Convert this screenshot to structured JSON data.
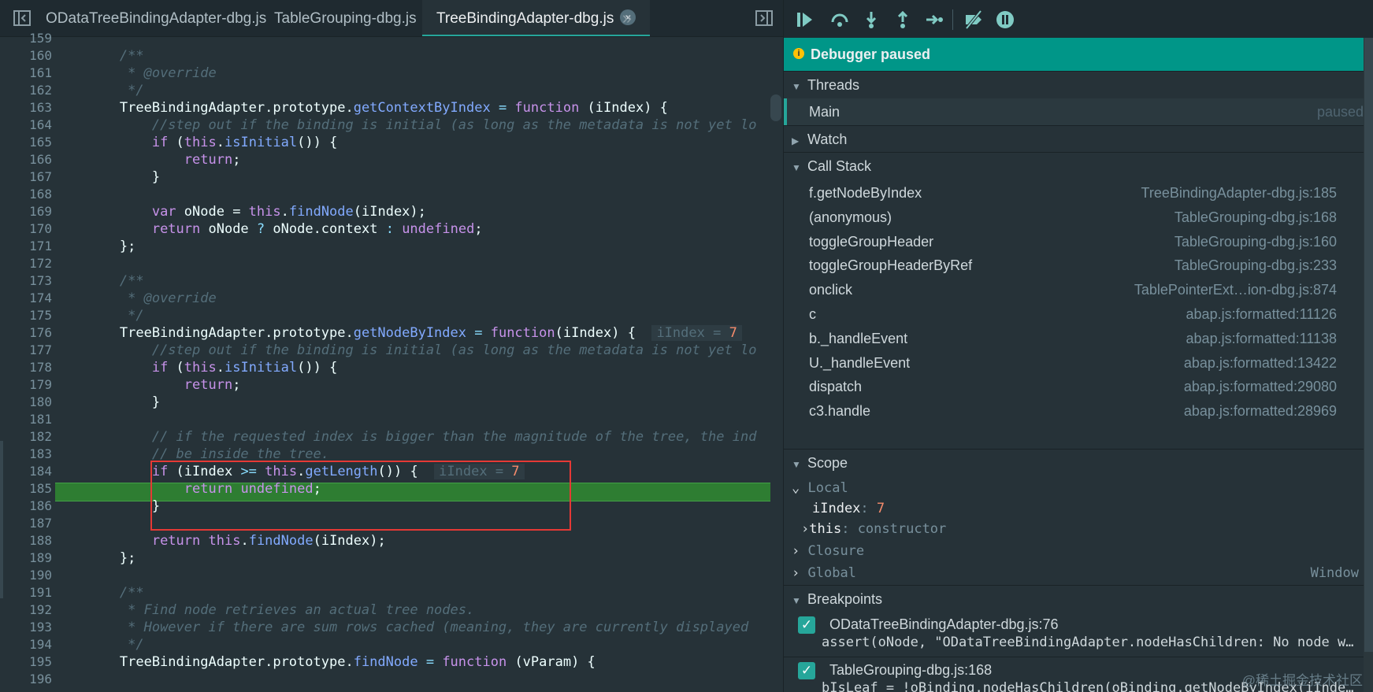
{
  "editor": {
    "tabs": [
      {
        "label": "ODataTreeBindingAdapter-dbg.js"
      },
      {
        "label": "TableGrouping-dbg.js"
      },
      {
        "label": "TreeBindingAdapter-dbg.js",
        "close": "×"
      }
    ],
    "more_tabs": "»",
    "lines": [
      {
        "n": "159",
        "t": []
      },
      {
        "n": "160",
        "t": [
          [
            "        ",
            ""
          ],
          [
            "/**",
            "cm"
          ]
        ]
      },
      {
        "n": "161",
        "t": [
          [
            "         ",
            ""
          ],
          [
            "* @override",
            "cm"
          ]
        ]
      },
      {
        "n": "162",
        "t": [
          [
            "         ",
            ""
          ],
          [
            "*/",
            "cm"
          ]
        ]
      },
      {
        "n": "163",
        "t": [
          [
            "        TreeBindingAdapter.prototype.",
            ""
          ],
          [
            "getContextByIndex",
            "fn"
          ],
          [
            " = ",
            "pn"
          ],
          [
            "function",
            "kw"
          ],
          [
            " (iIndex) {",
            ""
          ]
        ]
      },
      {
        "n": "164",
        "t": [
          [
            "            ",
            ""
          ],
          [
            "//step out if the binding is initial (as long as the metadata is not yet lo",
            "cm"
          ]
        ]
      },
      {
        "n": "165",
        "t": [
          [
            "            ",
            ""
          ],
          [
            "if",
            "kw"
          ],
          [
            " (",
            ""
          ],
          [
            "this",
            "kw"
          ],
          [
            ".",
            ""
          ],
          [
            "isInitial",
            "fn"
          ],
          [
            "()) {",
            ""
          ]
        ]
      },
      {
        "n": "166",
        "t": [
          [
            "                ",
            ""
          ],
          [
            "return",
            "kw"
          ],
          [
            ";",
            ""
          ]
        ]
      },
      {
        "n": "167",
        "t": [
          [
            "            }",
            ""
          ]
        ]
      },
      {
        "n": "168",
        "t": []
      },
      {
        "n": "169",
        "t": [
          [
            "            ",
            ""
          ],
          [
            "var",
            "kw"
          ],
          [
            " oNode = ",
            ""
          ],
          [
            "this",
            "kw"
          ],
          [
            ".",
            ""
          ],
          [
            "findNode",
            "fn"
          ],
          [
            "(iIndex);",
            ""
          ]
        ]
      },
      {
        "n": "170",
        "t": [
          [
            "            ",
            ""
          ],
          [
            "return",
            "kw"
          ],
          [
            " oNode ",
            ""
          ],
          [
            "?",
            "pn"
          ],
          [
            " oNode.context ",
            ""
          ],
          [
            ":",
            "pn"
          ],
          [
            " ",
            ""
          ],
          [
            "undefined",
            "kw"
          ],
          [
            ";",
            ""
          ]
        ]
      },
      {
        "n": "171",
        "t": [
          [
            "        };",
            ""
          ]
        ]
      },
      {
        "n": "172",
        "t": []
      },
      {
        "n": "173",
        "t": [
          [
            "        ",
            ""
          ],
          [
            "/**",
            "cm"
          ]
        ]
      },
      {
        "n": "174",
        "t": [
          [
            "         ",
            ""
          ],
          [
            "* @override",
            "cm"
          ]
        ]
      },
      {
        "n": "175",
        "t": [
          [
            "         ",
            ""
          ],
          [
            "*/",
            "cm"
          ]
        ]
      },
      {
        "n": "176",
        "t": [
          [
            "        TreeBindingAdapter.prototype.",
            ""
          ],
          [
            "getNodeByIndex",
            "fn"
          ],
          [
            " = ",
            "pn"
          ],
          [
            "function",
            "kw"
          ],
          [
            "(iIndex) {  ",
            ""
          ]
        ],
        "inline": {
          "name": "iIndex",
          "eq": " = ",
          "val": "7"
        }
      },
      {
        "n": "177",
        "t": [
          [
            "            ",
            ""
          ],
          [
            "//step out if the binding is initial (as long as the metadata is not yet lo",
            "cm"
          ]
        ]
      },
      {
        "n": "178",
        "t": [
          [
            "            ",
            ""
          ],
          [
            "if",
            "kw"
          ],
          [
            " (",
            ""
          ],
          [
            "this",
            "kw"
          ],
          [
            ".",
            ""
          ],
          [
            "isInitial",
            "fn"
          ],
          [
            "()) {",
            ""
          ]
        ]
      },
      {
        "n": "179",
        "t": [
          [
            "                ",
            ""
          ],
          [
            "return",
            "kw"
          ],
          [
            ";",
            ""
          ]
        ]
      },
      {
        "n": "180",
        "t": [
          [
            "            }",
            ""
          ]
        ]
      },
      {
        "n": "181",
        "t": []
      },
      {
        "n": "182",
        "t": [
          [
            "            ",
            ""
          ],
          [
            "// if the requested index is bigger than the magnitude of the tree, the ind",
            "cm"
          ]
        ]
      },
      {
        "n": "183",
        "t": [
          [
            "            ",
            ""
          ],
          [
            "// be inside the tree.",
            "cm"
          ]
        ]
      },
      {
        "n": "184",
        "t": [
          [
            "            ",
            ""
          ],
          [
            "if",
            "kw"
          ],
          [
            " (iIndex ",
            ""
          ],
          [
            ">=",
            "pn"
          ],
          [
            " ",
            ""
          ],
          [
            "this",
            "kw"
          ],
          [
            ".",
            ""
          ],
          [
            "getLength",
            "fn"
          ],
          [
            "()) {  ",
            ""
          ]
        ],
        "inline": {
          "name": "iIndex",
          "eq": " = ",
          "val": "7"
        }
      },
      {
        "n": "185",
        "t": [
          [
            "                ",
            ""
          ],
          [
            "return",
            "kw"
          ],
          [
            " ",
            ""
          ],
          [
            "undefined",
            "kw"
          ],
          [
            ";",
            ""
          ]
        ],
        "exec": true
      },
      {
        "n": "186",
        "t": [
          [
            "            }",
            ""
          ]
        ]
      },
      {
        "n": "187",
        "t": []
      },
      {
        "n": "188",
        "t": [
          [
            "            ",
            ""
          ],
          [
            "return",
            "kw"
          ],
          [
            " ",
            ""
          ],
          [
            "this",
            "kw"
          ],
          [
            ".",
            ""
          ],
          [
            "findNode",
            "fn"
          ],
          [
            "(iIndex);",
            ""
          ]
        ]
      },
      {
        "n": "189",
        "t": [
          [
            "        };",
            ""
          ]
        ]
      },
      {
        "n": "190",
        "t": []
      },
      {
        "n": "191",
        "t": [
          [
            "        ",
            ""
          ],
          [
            "/**",
            "cm"
          ]
        ]
      },
      {
        "n": "192",
        "t": [
          [
            "         ",
            ""
          ],
          [
            "* Find node retrieves an actual tree nodes.",
            "cm"
          ]
        ]
      },
      {
        "n": "193",
        "t": [
          [
            "         ",
            ""
          ],
          [
            "* However if there are sum rows cached (meaning, they are currently displayed",
            "cm"
          ]
        ]
      },
      {
        "n": "194",
        "t": [
          [
            "         ",
            ""
          ],
          [
            "*/",
            "cm"
          ]
        ]
      },
      {
        "n": "195",
        "t": [
          [
            "        TreeBindingAdapter.prototype.",
            ""
          ],
          [
            "findNode",
            "fn"
          ],
          [
            " = ",
            "pn"
          ],
          [
            "function",
            "kw"
          ],
          [
            " (vParam) {",
            ""
          ]
        ]
      },
      {
        "n": "196",
        "t": []
      }
    ]
  },
  "debugger": {
    "status": "Debugger paused",
    "sections": {
      "threads": "Threads",
      "watch": "Watch",
      "call_stack": "Call Stack",
      "scope": "Scope",
      "breakpoints": "Breakpoints"
    },
    "thread": {
      "name": "Main",
      "state": "paused"
    },
    "call_stack": [
      {
        "fn": "f.getNodeByIndex",
        "loc": "TreeBindingAdapter-dbg.js:185"
      },
      {
        "fn": "(anonymous)",
        "loc": "TableGrouping-dbg.js:168"
      },
      {
        "fn": "toggleGroupHeader",
        "loc": "TableGrouping-dbg.js:160"
      },
      {
        "fn": "toggleGroupHeaderByRef",
        "loc": "TableGrouping-dbg.js:233"
      },
      {
        "fn": "onclick",
        "loc": "TablePointerExt…ion-dbg.js:874"
      },
      {
        "fn": "c",
        "loc": "abap.js:formatted:11126"
      },
      {
        "fn": "b._handleEvent",
        "loc": "abap.js:formatted:11138"
      },
      {
        "fn": "U._handleEvent",
        "loc": "abap.js:formatted:13422"
      },
      {
        "fn": "dispatch",
        "loc": "abap.js:formatted:29080"
      },
      {
        "fn": "c3.handle",
        "loc": "abap.js:formatted:28969"
      }
    ],
    "scope": {
      "local_label": "Local",
      "vars": [
        {
          "key": "iIndex",
          "sep": ": ",
          "val": "7"
        },
        {
          "key": "this",
          "sep": ": ",
          "val": "constructor"
        }
      ],
      "closure_label": "Closure",
      "global_label": "Global",
      "global_value": "Window"
    },
    "breakpoints": [
      {
        "file": "ODataTreeBindingAdapter-dbg.js:76",
        "code": "assert(oNode, \"ODataTreeBindingAdapter.nodeHasChildren: No node was given\");"
      },
      {
        "file": "TableGrouping-dbg.js:168",
        "code": "bIsLeaf = !oBinding.nodeHasChildren(oBinding.getNodeByIndex(iIndex));"
      }
    ],
    "watermark": "@稀土掘金技术社区"
  },
  "colors": {
    "accent": "#009688",
    "exec_line": "#2e7d32",
    "highlight_box": "#e53935"
  }
}
